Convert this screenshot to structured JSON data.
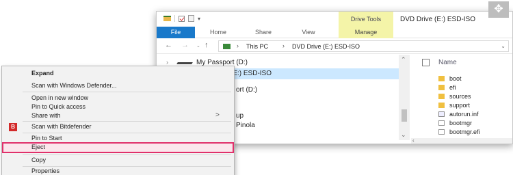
{
  "window": {
    "title": "DVD Drive (E:) ESD-ISO",
    "drive_tools_label": "Drive Tools",
    "tabs": [
      "File",
      "Home",
      "Share",
      "View",
      "Manage"
    ]
  },
  "address": {
    "this_pc": "This PC",
    "drive": "DVD Drive (E:) ESD-ISO",
    "separator": "›"
  },
  "nav": {
    "back_icon": "←",
    "forward_icon": "→",
    "up_icon": "↑",
    "dropdown_icon": "⌄"
  },
  "navpane": {
    "items": [
      {
        "label": "My Passport (D:)",
        "chevron": "›"
      },
      {
        "label": "DVD Drive (E:) ESD-ISO",
        "chevron": "›"
      }
    ],
    "partial_labels": [
      "ort (D:)",
      "up",
      "Pinola"
    ]
  },
  "content": {
    "column_name": "Name",
    "files": [
      {
        "name": "boot",
        "icon": "folder"
      },
      {
        "name": "efi",
        "icon": "folder"
      },
      {
        "name": "sources",
        "icon": "folder"
      },
      {
        "name": "support",
        "icon": "folder"
      },
      {
        "name": "autorun.inf",
        "icon": "gear"
      },
      {
        "name": "bootmgr",
        "icon": "doc"
      },
      {
        "name": "bootmgr.efi",
        "icon": "doc"
      }
    ]
  },
  "context_menu": {
    "items": [
      {
        "label": "Expand",
        "bold": true
      },
      {
        "label": "Scan with Windows Defender..."
      },
      {
        "label": "Open in new window"
      },
      {
        "label": "Pin to Quick access"
      },
      {
        "label": "Share with",
        "arrow": ">"
      },
      {
        "label": "Scan with Bitdefender",
        "icon_text": "B"
      },
      {
        "label": "Pin to Start"
      },
      {
        "label": "Eject",
        "highlighted": true
      },
      {
        "label": "Copy"
      },
      {
        "label": "Properties"
      }
    ]
  },
  "colors": {
    "file_tab": "#1979ca",
    "drive_tools_tab": "#f4f4a8",
    "selection": "#cce8ff",
    "eject_highlight_border": "#e0306a"
  }
}
